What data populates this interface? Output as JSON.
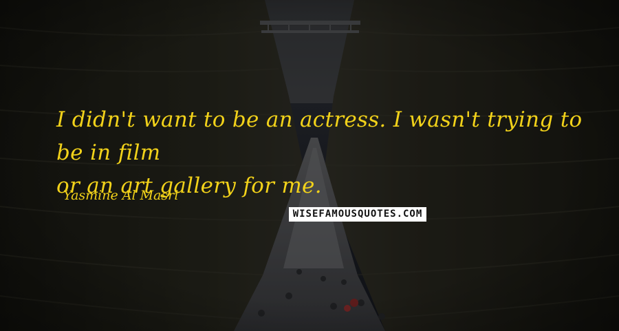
{
  "quote": {
    "text": "I didn't want to be an actress. I wasn't trying to be in film\nor an art gallery for me.",
    "author": "Yasmine Al Masri"
  },
  "watermark": {
    "text": "WISEFAMOUSQUOTES.COM"
  },
  "colors": {
    "quote_text": "#f2d21a",
    "background_dark": "#1c1c15",
    "canal_water": "#1e2129",
    "watermark_bg": "#ffffff",
    "watermark_text": "#111111"
  },
  "icons": [
    "ship-image"
  ]
}
